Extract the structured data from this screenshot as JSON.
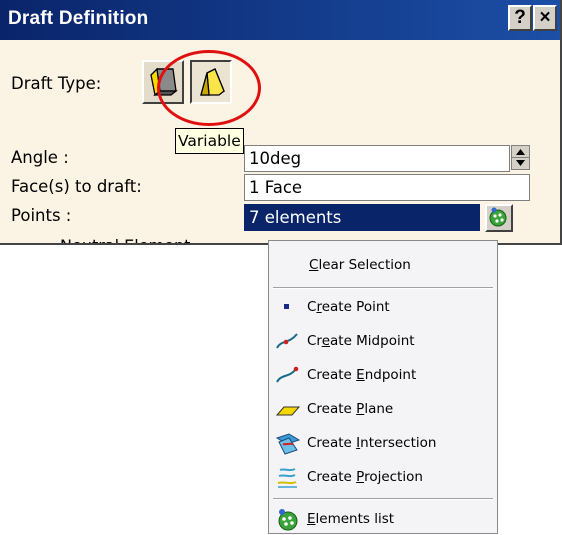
{
  "dialog": {
    "title": "Draft Definition",
    "help_button": "?",
    "close_button": "×",
    "draft_type_label": "Draft Type:",
    "draft_type_options": [
      "constant-draft-icon",
      "variable-draft-icon"
    ],
    "selected_draft_type": "Variable",
    "tooltip": "Variable",
    "angle_label": "Angle :",
    "angle_value": "10deg",
    "faces_label": "Face(s) to draft:",
    "faces_value": "1 Face",
    "points_label": "Points :",
    "points_value": "7 elements",
    "cut_off_row": "Neutral Element"
  },
  "context_menu": {
    "items": [
      {
        "pre": "",
        "u": "C",
        "post": "lear Selection",
        "icon": "none"
      },
      {
        "pre": "C",
        "u": "r",
        "post": "eate Point",
        "icon": "point-icon"
      },
      {
        "pre": "Cr",
        "u": "e",
        "post": "ate Midpoint",
        "icon": "midpoint-icon"
      },
      {
        "pre": "Create ",
        "u": "E",
        "post": "ndpoint",
        "icon": "endpoint-icon"
      },
      {
        "pre": "Create ",
        "u": "P",
        "post": "lane",
        "icon": "plane-icon"
      },
      {
        "pre": "Create ",
        "u": "I",
        "post": "ntersection",
        "icon": "intersection-icon"
      },
      {
        "pre": "Create ",
        "u": "P",
        "post": "rojection",
        "icon": "projection-icon"
      },
      {
        "pre": "",
        "u": "E",
        "post": "lements list",
        "icon": "elements-list-icon"
      }
    ]
  },
  "colors": {
    "titlebar": "#0a246a",
    "dialog_bg": "#fbf3e3",
    "selection": "#0a246a",
    "highlight_circle": "#e01010",
    "draft_icon_yellow": "#f5d800"
  }
}
